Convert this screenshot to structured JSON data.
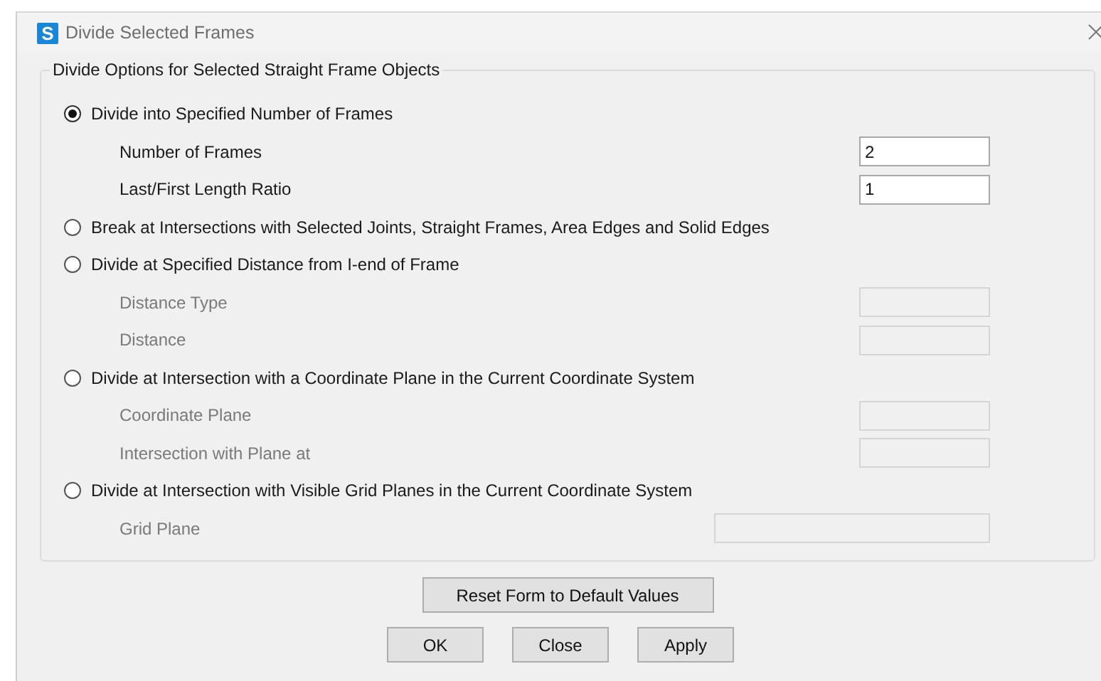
{
  "window": {
    "logo": "S",
    "title": "Divide Selected Frames"
  },
  "group": {
    "title": "Divide Options for Selected Straight Frame Objects",
    "options": [
      {
        "label": "Divide into Specified Number of Frames",
        "selected": true,
        "fields": [
          {
            "label": "Number of Frames",
            "value": "2",
            "disabled": false,
            "kind": "short"
          },
          {
            "label": "Last/First Length Ratio",
            "value": "1",
            "disabled": false,
            "kind": "short"
          }
        ]
      },
      {
        "label": "Break at Intersections with Selected Joints, Straight Frames, Area Edges and Solid Edges",
        "selected": false
      },
      {
        "label": "Divide at Specified Distance from I-end of Frame",
        "selected": false,
        "fields": [
          {
            "label": "Distance Type",
            "disabled": true,
            "kind": "short"
          },
          {
            "label": "Distance",
            "disabled": true,
            "kind": "short"
          }
        ]
      },
      {
        "label": "Divide at Intersection with a Coordinate Plane in the Current Coordinate System",
        "selected": false,
        "fields": [
          {
            "label": "Coordinate Plane",
            "disabled": true,
            "kind": "short"
          },
          {
            "label": "Intersection with Plane at",
            "disabled": true,
            "kind": "short"
          }
        ]
      },
      {
        "label": "Divide at Intersection with Visible Grid Planes in the Current Coordinate System",
        "selected": false,
        "fields": [
          {
            "label": "Grid Plane",
            "disabled": true,
            "kind": "long"
          }
        ]
      }
    ]
  },
  "reset_button": "Reset Form to Default Values",
  "buttons": [
    "OK",
    "Close",
    "Apply"
  ]
}
